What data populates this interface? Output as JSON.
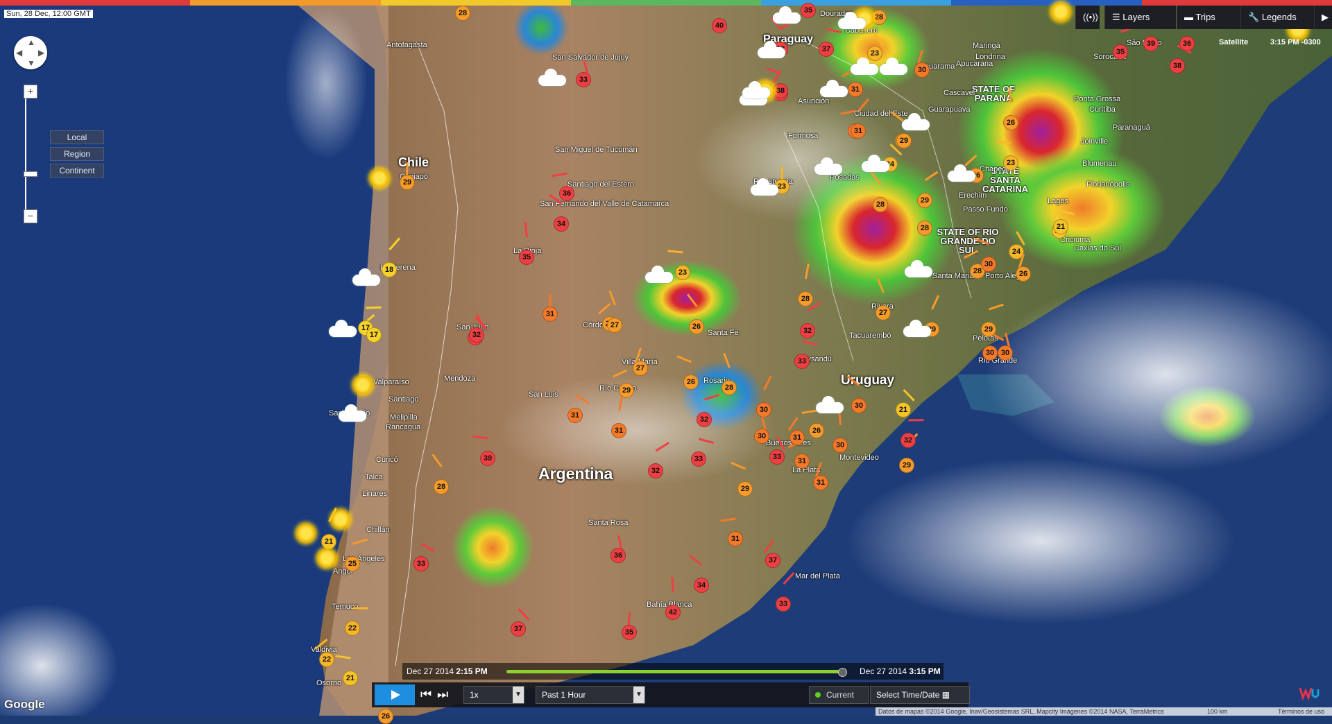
{
  "timestamp": "Sun, 28 Dec, 12:00 GMT",
  "map_view": {
    "scale_options": [
      "Local",
      "Region",
      "Continent"
    ]
  },
  "topbar": {
    "live_icon": "broadcast-icon",
    "layers": "Layers",
    "trips": "Trips",
    "legends": "Legends",
    "satellite_label": "Satellite",
    "local_time": "3:15 PM -0300"
  },
  "timeline": {
    "start": "Dec 27 2014",
    "start_time": "2:15 PM",
    "end": "Dec 27 2014",
    "end_time": "3:15 PM",
    "progress": 1.0
  },
  "controls": {
    "speed": "1x",
    "range": "Past 1 Hour",
    "current": "Current",
    "select_time": "Select Time/Date"
  },
  "attribution": "Datos de mapas ©2014 Google, Inav/Geosistemas SRL, Mapcity Imágenes ©2014 NASA, TerraMetrics",
  "scale_bar": "100 km",
  "terms": "Términos de uso",
  "google_logo": "Google",
  "countries": [
    "Chile",
    "Argentina",
    "Uruguay",
    "Paraguay"
  ],
  "states": [
    "STATE OF PARANÁ",
    "STATE SANTA CATARINA",
    "STATE OF RIO GRANDE DO SUL"
  ],
  "cities": [
    "Antofagasta",
    "Copiapó",
    "La Serena",
    "Valparaíso",
    "Santiago",
    "San Antonio",
    "Melipilla",
    "Rancagua",
    "Curicó",
    "Talca",
    "Linares",
    "Chillán",
    "Los Ángeles",
    "Angol",
    "Temuco",
    "Valdivia",
    "Osorno",
    "San Salvador de Jujuy",
    "San Miguel de Tucumán",
    "Santiago del Estero",
    "San Fernando del Valle de Catamarca",
    "La Rioja",
    "San Juan",
    "Mendoza",
    "San Luis",
    "Córdoba",
    "Villa María",
    "Río Cuarto",
    "Santa Fe",
    "Rosario",
    "Buenos Aires",
    "La Plata",
    "Santa Rosa",
    "Bahía Blanca",
    "Mar del Plata",
    "Formosa",
    "Resistencia",
    "Posadas",
    "Asunción",
    "Dourados",
    "Caballero",
    "Maringá",
    "Londrina",
    "Apucarana",
    "Umuarama",
    "Cascavel",
    "Sorocaba",
    "São Paulo",
    "Ponta Grossa",
    "Guarapuava",
    "Curitiba",
    "Paranaguá",
    "Joinville",
    "Blumenau",
    "Florianópolis",
    "Lages",
    "Chapecó",
    "Erechim",
    "Passo Fundo",
    "Caxias do Sul",
    "Criciúma",
    "Porto Alegre",
    "Santa Maria",
    "Rivera",
    "Tacuarembó",
    "Pelotas",
    "Rio Grande",
    "Paysandú",
    "Montevideo",
    "Ciudad del Este"
  ],
  "stations": [
    {
      "t": "28",
      "c": "#f79b2a"
    },
    {
      "t": "35",
      "c": "#ee4043"
    },
    {
      "t": "28",
      "c": "#f79b2a"
    },
    {
      "t": "38",
      "c": "#ee4043"
    },
    {
      "t": "40",
      "c": "#ee4043"
    },
    {
      "t": "38",
      "c": "#ee4043"
    },
    {
      "t": "37",
      "c": "#ee4043"
    },
    {
      "t": "23",
      "c": "#f7b52a"
    },
    {
      "t": "30",
      "c": "#f47a2a"
    },
    {
      "t": "31",
      "c": "#f47a2a"
    },
    {
      "t": "38",
      "c": "#ee4043"
    },
    {
      "t": "36",
      "c": "#ee4043"
    },
    {
      "t": "39",
      "c": "#ee4043"
    },
    {
      "t": "35",
      "c": "#ee4043"
    },
    {
      "t": "38",
      "c": "#ee4043"
    },
    {
      "t": "33",
      "c": "#ee4043"
    },
    {
      "t": "38",
      "c": "#ee4043"
    },
    {
      "t": "31",
      "c": "#f47a2a"
    },
    {
      "t": "29",
      "c": "#f79b2a"
    },
    {
      "t": "26",
      "c": "#f79b2a"
    },
    {
      "t": "31",
      "c": "#f47a2a"
    },
    {
      "t": "29",
      "c": "#f79b2a"
    },
    {
      "t": "24",
      "c": "#f7b52a"
    },
    {
      "t": "23",
      "c": "#f7b52a"
    },
    {
      "t": "26",
      "c": "#f79b2a"
    },
    {
      "t": "23",
      "c": "#f7b52a"
    },
    {
      "t": "28",
      "c": "#f79b2a"
    },
    {
      "t": "28",
      "c": "#f79b2a"
    },
    {
      "t": "29",
      "c": "#f79b2a"
    },
    {
      "t": "21",
      "c": "#f7c32a"
    },
    {
      "t": "24",
      "c": "#f7b52a"
    },
    {
      "t": "26",
      "c": "#f79b2a"
    },
    {
      "t": "28",
      "c": "#f79b2a"
    },
    {
      "t": "30",
      "c": "#f47a2a"
    },
    {
      "t": "27",
      "c": "#f79b2a"
    },
    {
      "t": "29",
      "c": "#f79b2a"
    },
    {
      "t": "29",
      "c": "#f79b2a"
    },
    {
      "t": "30",
      "c": "#f47a2a"
    },
    {
      "t": "30",
      "c": "#f47a2a"
    },
    {
      "t": "21",
      "c": "#f7c32a"
    },
    {
      "t": "36",
      "c": "#ee4043"
    },
    {
      "t": "34",
      "c": "#ee4043"
    },
    {
      "t": "35",
      "c": "#ee4043"
    },
    {
      "t": "18",
      "c": "#f7d22a"
    },
    {
      "t": "17",
      "c": "#f7d22a"
    },
    {
      "t": "32",
      "c": "#ee4043"
    },
    {
      "t": "31",
      "c": "#f47a2a"
    },
    {
      "t": "27",
      "c": "#f79b2a"
    },
    {
      "t": "23",
      "c": "#f7b52a"
    },
    {
      "t": "26",
      "c": "#f79b2a"
    },
    {
      "t": "28",
      "c": "#f79b2a"
    },
    {
      "t": "32",
      "c": "#ee4043"
    },
    {
      "t": "33",
      "c": "#ee4043"
    },
    {
      "t": "32",
      "c": "#ee4043"
    },
    {
      "t": "27",
      "c": "#f79b2a"
    },
    {
      "t": "29",
      "c": "#f79b2a"
    },
    {
      "t": "26",
      "c": "#f79b2a"
    },
    {
      "t": "28",
      "c": "#f79b2a"
    },
    {
      "t": "30",
      "c": "#f47a2a"
    },
    {
      "t": "32",
      "c": "#ee4043"
    },
    {
      "t": "31",
      "c": "#f47a2a"
    },
    {
      "t": "30",
      "c": "#f47a2a"
    },
    {
      "t": "31",
      "c": "#f47a2a"
    },
    {
      "t": "26",
      "c": "#f79b2a"
    },
    {
      "t": "30",
      "c": "#f47a2a"
    },
    {
      "t": "30",
      "c": "#f47a2a"
    },
    {
      "t": "29",
      "c": "#f79b2a"
    },
    {
      "t": "32",
      "c": "#ee4043"
    },
    {
      "t": "21",
      "c": "#f7c32a"
    },
    {
      "t": "29",
      "c": "#f79b2a"
    },
    {
      "t": "17",
      "c": "#f7d22a"
    },
    {
      "t": "39",
      "c": "#ee4043"
    },
    {
      "t": "28",
      "c": "#f79b2a"
    },
    {
      "t": "31",
      "c": "#f47a2a"
    },
    {
      "t": "32",
      "c": "#ee4043"
    },
    {
      "t": "33",
      "c": "#ee4043"
    },
    {
      "t": "33",
      "c": "#ee4043"
    },
    {
      "t": "31",
      "c": "#f47a2a"
    },
    {
      "t": "31",
      "c": "#f47a2a"
    },
    {
      "t": "29",
      "c": "#f79b2a"
    },
    {
      "t": "27",
      "c": "#f79b2a"
    },
    {
      "t": "21",
      "c": "#f7c32a"
    },
    {
      "t": "25",
      "c": "#f79b2a"
    },
    {
      "t": "33",
      "c": "#ee4043"
    },
    {
      "t": "36",
      "c": "#ee4043"
    },
    {
      "t": "37",
      "c": "#ee4043"
    },
    {
      "t": "31",
      "c": "#f47a2a"
    },
    {
      "t": "34",
      "c": "#ee4043"
    },
    {
      "t": "42",
      "c": "#ee4043"
    },
    {
      "t": "33",
      "c": "#ee4043"
    },
    {
      "t": "22",
      "c": "#f7b52a"
    },
    {
      "t": "37",
      "c": "#ee4043"
    },
    {
      "t": "35",
      "c": "#ee4043"
    },
    {
      "t": "22",
      "c": "#f7b52a"
    },
    {
      "t": "21",
      "c": "#f7c32a"
    },
    {
      "t": "26",
      "c": "#f79b2a"
    }
  ]
}
